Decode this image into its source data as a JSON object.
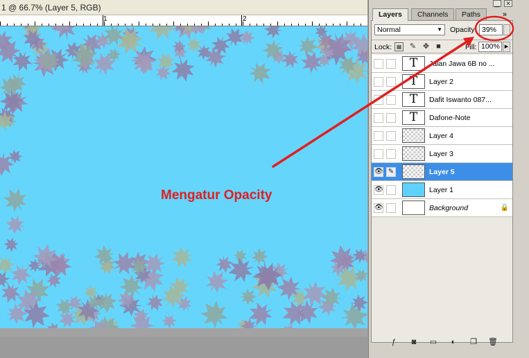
{
  "document": {
    "title": "1 @ 66.7% (Layer 5, RGB)",
    "ruler_numbers": [
      "1",
      "2"
    ]
  },
  "annotation": {
    "text": "Mengatur Opacity",
    "color": "#e01f1f"
  },
  "panel": {
    "tabs": [
      "Layers",
      "Channels",
      "Paths"
    ],
    "more": "»",
    "blend_mode": "Normal",
    "opacity_label": "Opacity:",
    "opacity_value": "39%",
    "lock_label": "Lock:",
    "fill_label": "Fill:",
    "fill_value": "100%",
    "layers": [
      {
        "name": "Jalan Jawa 6B no ...",
        "type": "text",
        "visible": false,
        "selected": false
      },
      {
        "name": "Layer 2",
        "type": "text",
        "visible": false,
        "selected": false
      },
      {
        "name": "Dafit Iswanto 087...",
        "type": "text",
        "visible": false,
        "selected": false
      },
      {
        "name": "Dafone-Note",
        "type": "text",
        "visible": false,
        "selected": false
      },
      {
        "name": "Layer 4",
        "type": "image",
        "visible": false,
        "selected": false
      },
      {
        "name": "Layer 3",
        "type": "image",
        "visible": false,
        "selected": false
      },
      {
        "name": "Layer 5",
        "type": "image",
        "visible": true,
        "selected": true
      },
      {
        "name": "Layer 1",
        "type": "fill",
        "visible": true,
        "selected": false
      },
      {
        "name": "Background",
        "type": "background",
        "visible": true,
        "selected": false,
        "locked": true
      }
    ]
  },
  "colors": {
    "canvas": "#66d5fb",
    "selection": "#3d8ee6",
    "arrow": "#e01f1f"
  }
}
